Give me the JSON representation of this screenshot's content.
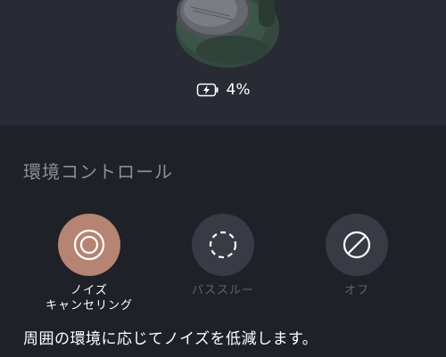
{
  "battery": {
    "level_text": "4%",
    "icon": "battery-charging-icon"
  },
  "environment_control": {
    "title": "環境コントロール",
    "modes": [
      {
        "id": "noise-cancelling",
        "label_line1": "ノイズ",
        "label_line2": "キャンセリング",
        "icon": "noise-cancelling-icon",
        "active": true
      },
      {
        "id": "pass-through",
        "label_line1": "パススルー",
        "label_line2": "",
        "icon": "pass-through-icon",
        "active": false
      },
      {
        "id": "off",
        "label_line1": "オフ",
        "label_line2": "",
        "icon": "off-icon",
        "active": false
      }
    ],
    "description": "周囲の環境に応じてノイズを低減します。"
  },
  "colors": {
    "accent": "#b58472",
    "background": "#1f2128",
    "hero_background": "#282b33",
    "inactive_circle": "#383b44"
  }
}
